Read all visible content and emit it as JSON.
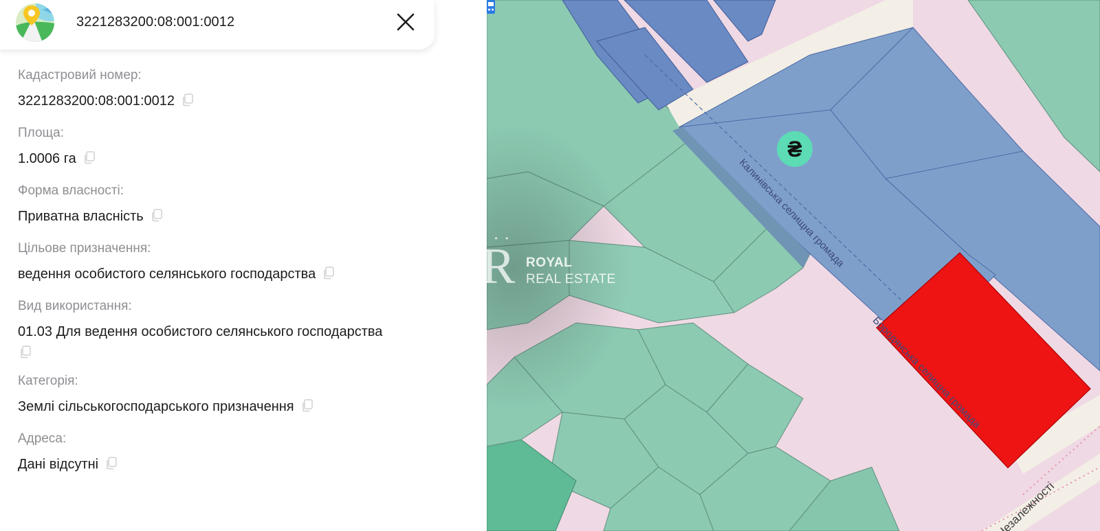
{
  "header": {
    "title": "3221283200:08:001:0012",
    "icon": "map-pin-app-icon",
    "close_icon": "close-icon"
  },
  "fields": [
    {
      "label": "Кадастровий номер:",
      "value": "3221283200:08:001:0012"
    },
    {
      "label": "Площа:",
      "value": "1.0006 га"
    },
    {
      "label": "Форма власності:",
      "value": "Приватна власність"
    },
    {
      "label": "Цільове призначення:",
      "value": "ведення особистого селянського господарства"
    },
    {
      "label": "Вид використання:",
      "value": "01.03 Для ведення особистого селянського господарства"
    },
    {
      "label": "Категорія:",
      "value": "Землі сільськогосподарського призначення"
    },
    {
      "label": "Адреса:",
      "value": "Дані відсутні"
    }
  ],
  "map": {
    "street_label_1": "Калинівська селищна громада",
    "street_label_2": "Бородянська селищна громада",
    "street_label_3": "Незалежності",
    "currency_marker": "₴",
    "watermark": {
      "letter": "R",
      "crown": "• • •",
      "line1": "ROYAL",
      "line2": "REAL ESTATE"
    }
  },
  "colors": {
    "parcel_green": "#8ccab2",
    "parcel_dark_green": "#5fba96",
    "parcel_blue": "#7f9fcb",
    "parcel_blue_dark": "#6a8ac4",
    "selected_parcel": "#ee1414",
    "residential_pink": "#efd9e4",
    "road": "#f3efe6",
    "label_gray": "#8e8e93",
    "marker_mint": "#5cdbb5"
  }
}
